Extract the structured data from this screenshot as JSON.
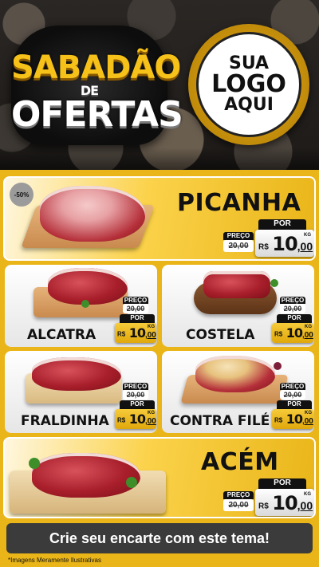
{
  "header": {
    "title_line1": "SABADÃO",
    "title_line2": "DE",
    "title_line3": "OFERTAS",
    "logo_line1": "SUA",
    "logo_line2": "LOGO",
    "logo_line3": "AQUI"
  },
  "labels": {
    "por": "POR",
    "preco": "PREÇO",
    "currency": "R$",
    "unit": "KG"
  },
  "featured": [
    {
      "name": "PICANHA",
      "badge": "-50%",
      "old_price": "20,00",
      "price_int": "10",
      "price_dec": ",00"
    },
    {
      "name": "ACÉM",
      "old_price": "20,00",
      "price_int": "10",
      "price_dec": ",00"
    }
  ],
  "grid": [
    {
      "name": "ALCATRA",
      "old_price": "20,00",
      "price_int": "10",
      "price_dec": ",00"
    },
    {
      "name": "COSTELA",
      "old_price": "20,00",
      "price_int": "10",
      "price_dec": ",00"
    },
    {
      "name": "FRALDINHA",
      "old_price": "20,00",
      "price_int": "10",
      "price_dec": ",00"
    },
    {
      "name": "CONTRA FILÉ",
      "old_price": "20,00",
      "price_int": "10",
      "price_dec": ",00"
    }
  ],
  "footer": {
    "cta": "Crie seu encarte com este tema!",
    "disclaimer": "*Imagens Meramente Ilustrativas"
  },
  "colors": {
    "brand_yellow": "#e9b518",
    "dark": "#161616",
    "gray_card": "#e6e6e6"
  }
}
